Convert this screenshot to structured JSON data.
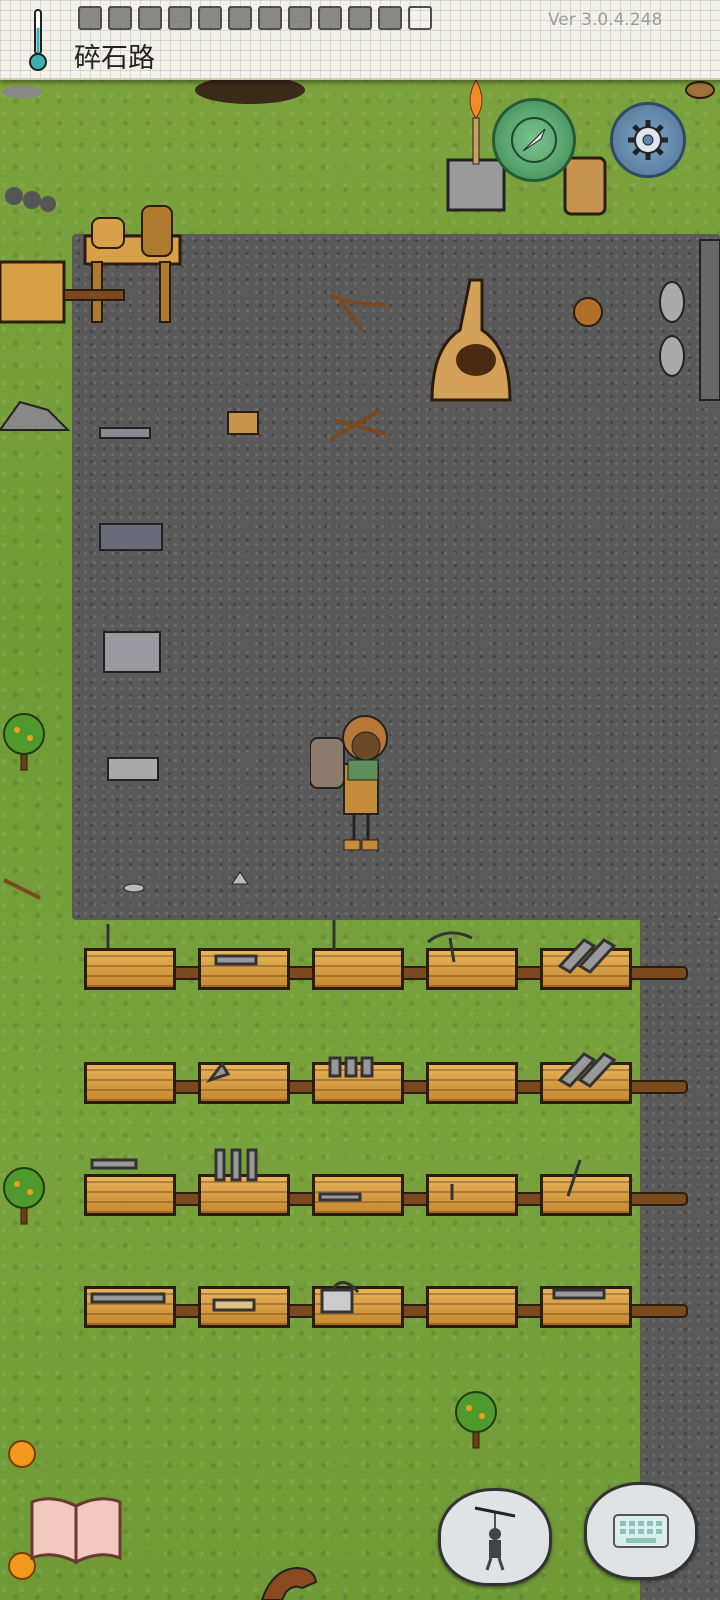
{
  "hud": {
    "location": "碎石路",
    "version": "Ver 3.0.4.248",
    "temperature_icon": "thermometer-icon",
    "inventory_slots": 12
  },
  "buttons": {
    "compass": "compass-icon",
    "settings": "gear-icon",
    "journal": "book-icon",
    "emote": "puppet-icon",
    "keyboard": "keyboard-icon"
  },
  "colors": {
    "grass": "#7ea43f",
    "road": "#5a5a5a",
    "paper": "#f4f1e8",
    "crate": "#d9a04a",
    "compass": "#4f9e68",
    "settings": "#5f86aa"
  },
  "crate_rows": [
    {
      "tools": [
        "chisel",
        "mallets",
        "stake",
        "pickaxe",
        "shovels"
      ]
    },
    {
      "tools": [
        "empty",
        "knife",
        "axes",
        "empty",
        "shovels"
      ]
    },
    {
      "tools": [
        "hoes",
        "pipes",
        "blade",
        "awl",
        "shaft"
      ]
    },
    {
      "tools": [
        "hammers",
        "bundles",
        "saw",
        "empty",
        "hammers"
      ]
    }
  ]
}
